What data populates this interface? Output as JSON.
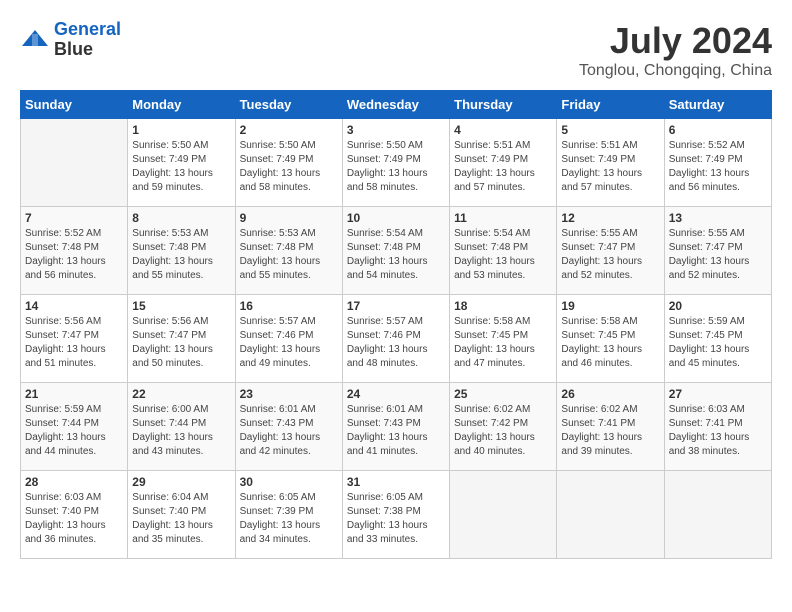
{
  "header": {
    "logo_line1": "General",
    "logo_line2": "Blue",
    "month_year": "July 2024",
    "location": "Tonglou, Chongqing, China"
  },
  "weekdays": [
    "Sunday",
    "Monday",
    "Tuesday",
    "Wednesday",
    "Thursday",
    "Friday",
    "Saturday"
  ],
  "weeks": [
    [
      {
        "day": "",
        "info": ""
      },
      {
        "day": "1",
        "info": "Sunrise: 5:50 AM\nSunset: 7:49 PM\nDaylight: 13 hours\nand 59 minutes."
      },
      {
        "day": "2",
        "info": "Sunrise: 5:50 AM\nSunset: 7:49 PM\nDaylight: 13 hours\nand 58 minutes."
      },
      {
        "day": "3",
        "info": "Sunrise: 5:50 AM\nSunset: 7:49 PM\nDaylight: 13 hours\nand 58 minutes."
      },
      {
        "day": "4",
        "info": "Sunrise: 5:51 AM\nSunset: 7:49 PM\nDaylight: 13 hours\nand 57 minutes."
      },
      {
        "day": "5",
        "info": "Sunrise: 5:51 AM\nSunset: 7:49 PM\nDaylight: 13 hours\nand 57 minutes."
      },
      {
        "day": "6",
        "info": "Sunrise: 5:52 AM\nSunset: 7:49 PM\nDaylight: 13 hours\nand 56 minutes."
      }
    ],
    [
      {
        "day": "7",
        "info": "Sunrise: 5:52 AM\nSunset: 7:48 PM\nDaylight: 13 hours\nand 56 minutes."
      },
      {
        "day": "8",
        "info": "Sunrise: 5:53 AM\nSunset: 7:48 PM\nDaylight: 13 hours\nand 55 minutes."
      },
      {
        "day": "9",
        "info": "Sunrise: 5:53 AM\nSunset: 7:48 PM\nDaylight: 13 hours\nand 55 minutes."
      },
      {
        "day": "10",
        "info": "Sunrise: 5:54 AM\nSunset: 7:48 PM\nDaylight: 13 hours\nand 54 minutes."
      },
      {
        "day": "11",
        "info": "Sunrise: 5:54 AM\nSunset: 7:48 PM\nDaylight: 13 hours\nand 53 minutes."
      },
      {
        "day": "12",
        "info": "Sunrise: 5:55 AM\nSunset: 7:47 PM\nDaylight: 13 hours\nand 52 minutes."
      },
      {
        "day": "13",
        "info": "Sunrise: 5:55 AM\nSunset: 7:47 PM\nDaylight: 13 hours\nand 52 minutes."
      }
    ],
    [
      {
        "day": "14",
        "info": "Sunrise: 5:56 AM\nSunset: 7:47 PM\nDaylight: 13 hours\nand 51 minutes."
      },
      {
        "day": "15",
        "info": "Sunrise: 5:56 AM\nSunset: 7:47 PM\nDaylight: 13 hours\nand 50 minutes."
      },
      {
        "day": "16",
        "info": "Sunrise: 5:57 AM\nSunset: 7:46 PM\nDaylight: 13 hours\nand 49 minutes."
      },
      {
        "day": "17",
        "info": "Sunrise: 5:57 AM\nSunset: 7:46 PM\nDaylight: 13 hours\nand 48 minutes."
      },
      {
        "day": "18",
        "info": "Sunrise: 5:58 AM\nSunset: 7:45 PM\nDaylight: 13 hours\nand 47 minutes."
      },
      {
        "day": "19",
        "info": "Sunrise: 5:58 AM\nSunset: 7:45 PM\nDaylight: 13 hours\nand 46 minutes."
      },
      {
        "day": "20",
        "info": "Sunrise: 5:59 AM\nSunset: 7:45 PM\nDaylight: 13 hours\nand 45 minutes."
      }
    ],
    [
      {
        "day": "21",
        "info": "Sunrise: 5:59 AM\nSunset: 7:44 PM\nDaylight: 13 hours\nand 44 minutes."
      },
      {
        "day": "22",
        "info": "Sunrise: 6:00 AM\nSunset: 7:44 PM\nDaylight: 13 hours\nand 43 minutes."
      },
      {
        "day": "23",
        "info": "Sunrise: 6:01 AM\nSunset: 7:43 PM\nDaylight: 13 hours\nand 42 minutes."
      },
      {
        "day": "24",
        "info": "Sunrise: 6:01 AM\nSunset: 7:43 PM\nDaylight: 13 hours\nand 41 minutes."
      },
      {
        "day": "25",
        "info": "Sunrise: 6:02 AM\nSunset: 7:42 PM\nDaylight: 13 hours\nand 40 minutes."
      },
      {
        "day": "26",
        "info": "Sunrise: 6:02 AM\nSunset: 7:41 PM\nDaylight: 13 hours\nand 39 minutes."
      },
      {
        "day": "27",
        "info": "Sunrise: 6:03 AM\nSunset: 7:41 PM\nDaylight: 13 hours\nand 38 minutes."
      }
    ],
    [
      {
        "day": "28",
        "info": "Sunrise: 6:03 AM\nSunset: 7:40 PM\nDaylight: 13 hours\nand 36 minutes."
      },
      {
        "day": "29",
        "info": "Sunrise: 6:04 AM\nSunset: 7:40 PM\nDaylight: 13 hours\nand 35 minutes."
      },
      {
        "day": "30",
        "info": "Sunrise: 6:05 AM\nSunset: 7:39 PM\nDaylight: 13 hours\nand 34 minutes."
      },
      {
        "day": "31",
        "info": "Sunrise: 6:05 AM\nSunset: 7:38 PM\nDaylight: 13 hours\nand 33 minutes."
      },
      {
        "day": "",
        "info": ""
      },
      {
        "day": "",
        "info": ""
      },
      {
        "day": "",
        "info": ""
      }
    ]
  ]
}
